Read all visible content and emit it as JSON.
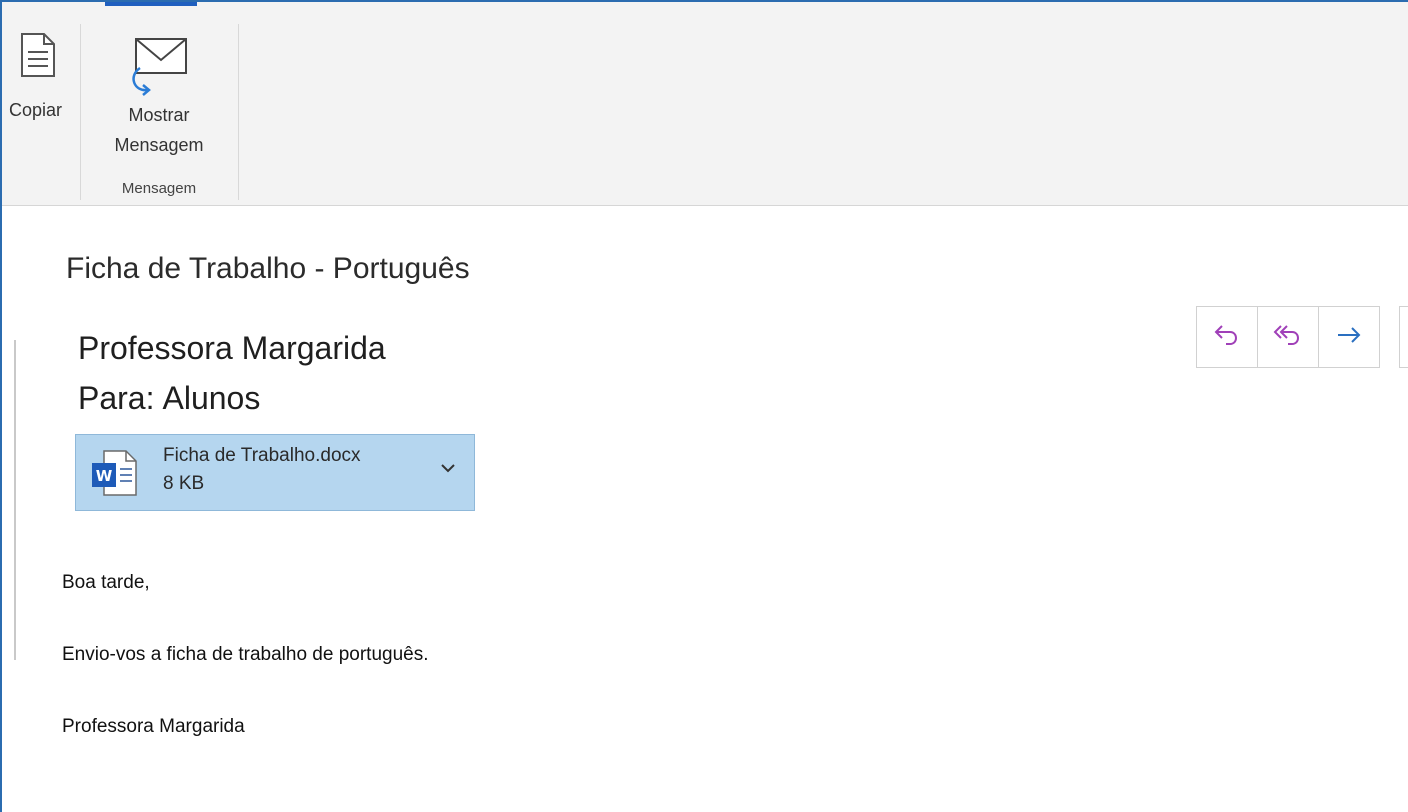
{
  "ribbon": {
    "copy_label": "Copiar",
    "show_message_label_line1": "Mostrar",
    "show_message_label_line2": "Mensagem",
    "group_label": "Mensagem"
  },
  "message": {
    "subject": "Ficha de Trabalho - Português",
    "sender": "Professora Margarida",
    "to_label": "Para:",
    "to_value": "Alunos",
    "attachment": {
      "name": "Ficha de Trabalho.docx",
      "size": "8 KB",
      "icon": "word-doc-icon"
    },
    "body": {
      "greeting": "Boa tarde,",
      "line": "Envio-vos a ficha de trabalho de português.",
      "signature": "Professora Margarida"
    }
  },
  "actions": [
    {
      "name": "reply",
      "icon": "reply-icon"
    },
    {
      "name": "reply-all",
      "icon": "reply-all-icon"
    },
    {
      "name": "forward",
      "icon": "forward-icon"
    }
  ],
  "colors": {
    "ribbon_bg": "#f3f3f3",
    "accent": "#1f5fbf",
    "attachment_bg": "#b5d6ef",
    "reply_icon": "#a040b8",
    "forward_icon": "#2a6fc0"
  }
}
